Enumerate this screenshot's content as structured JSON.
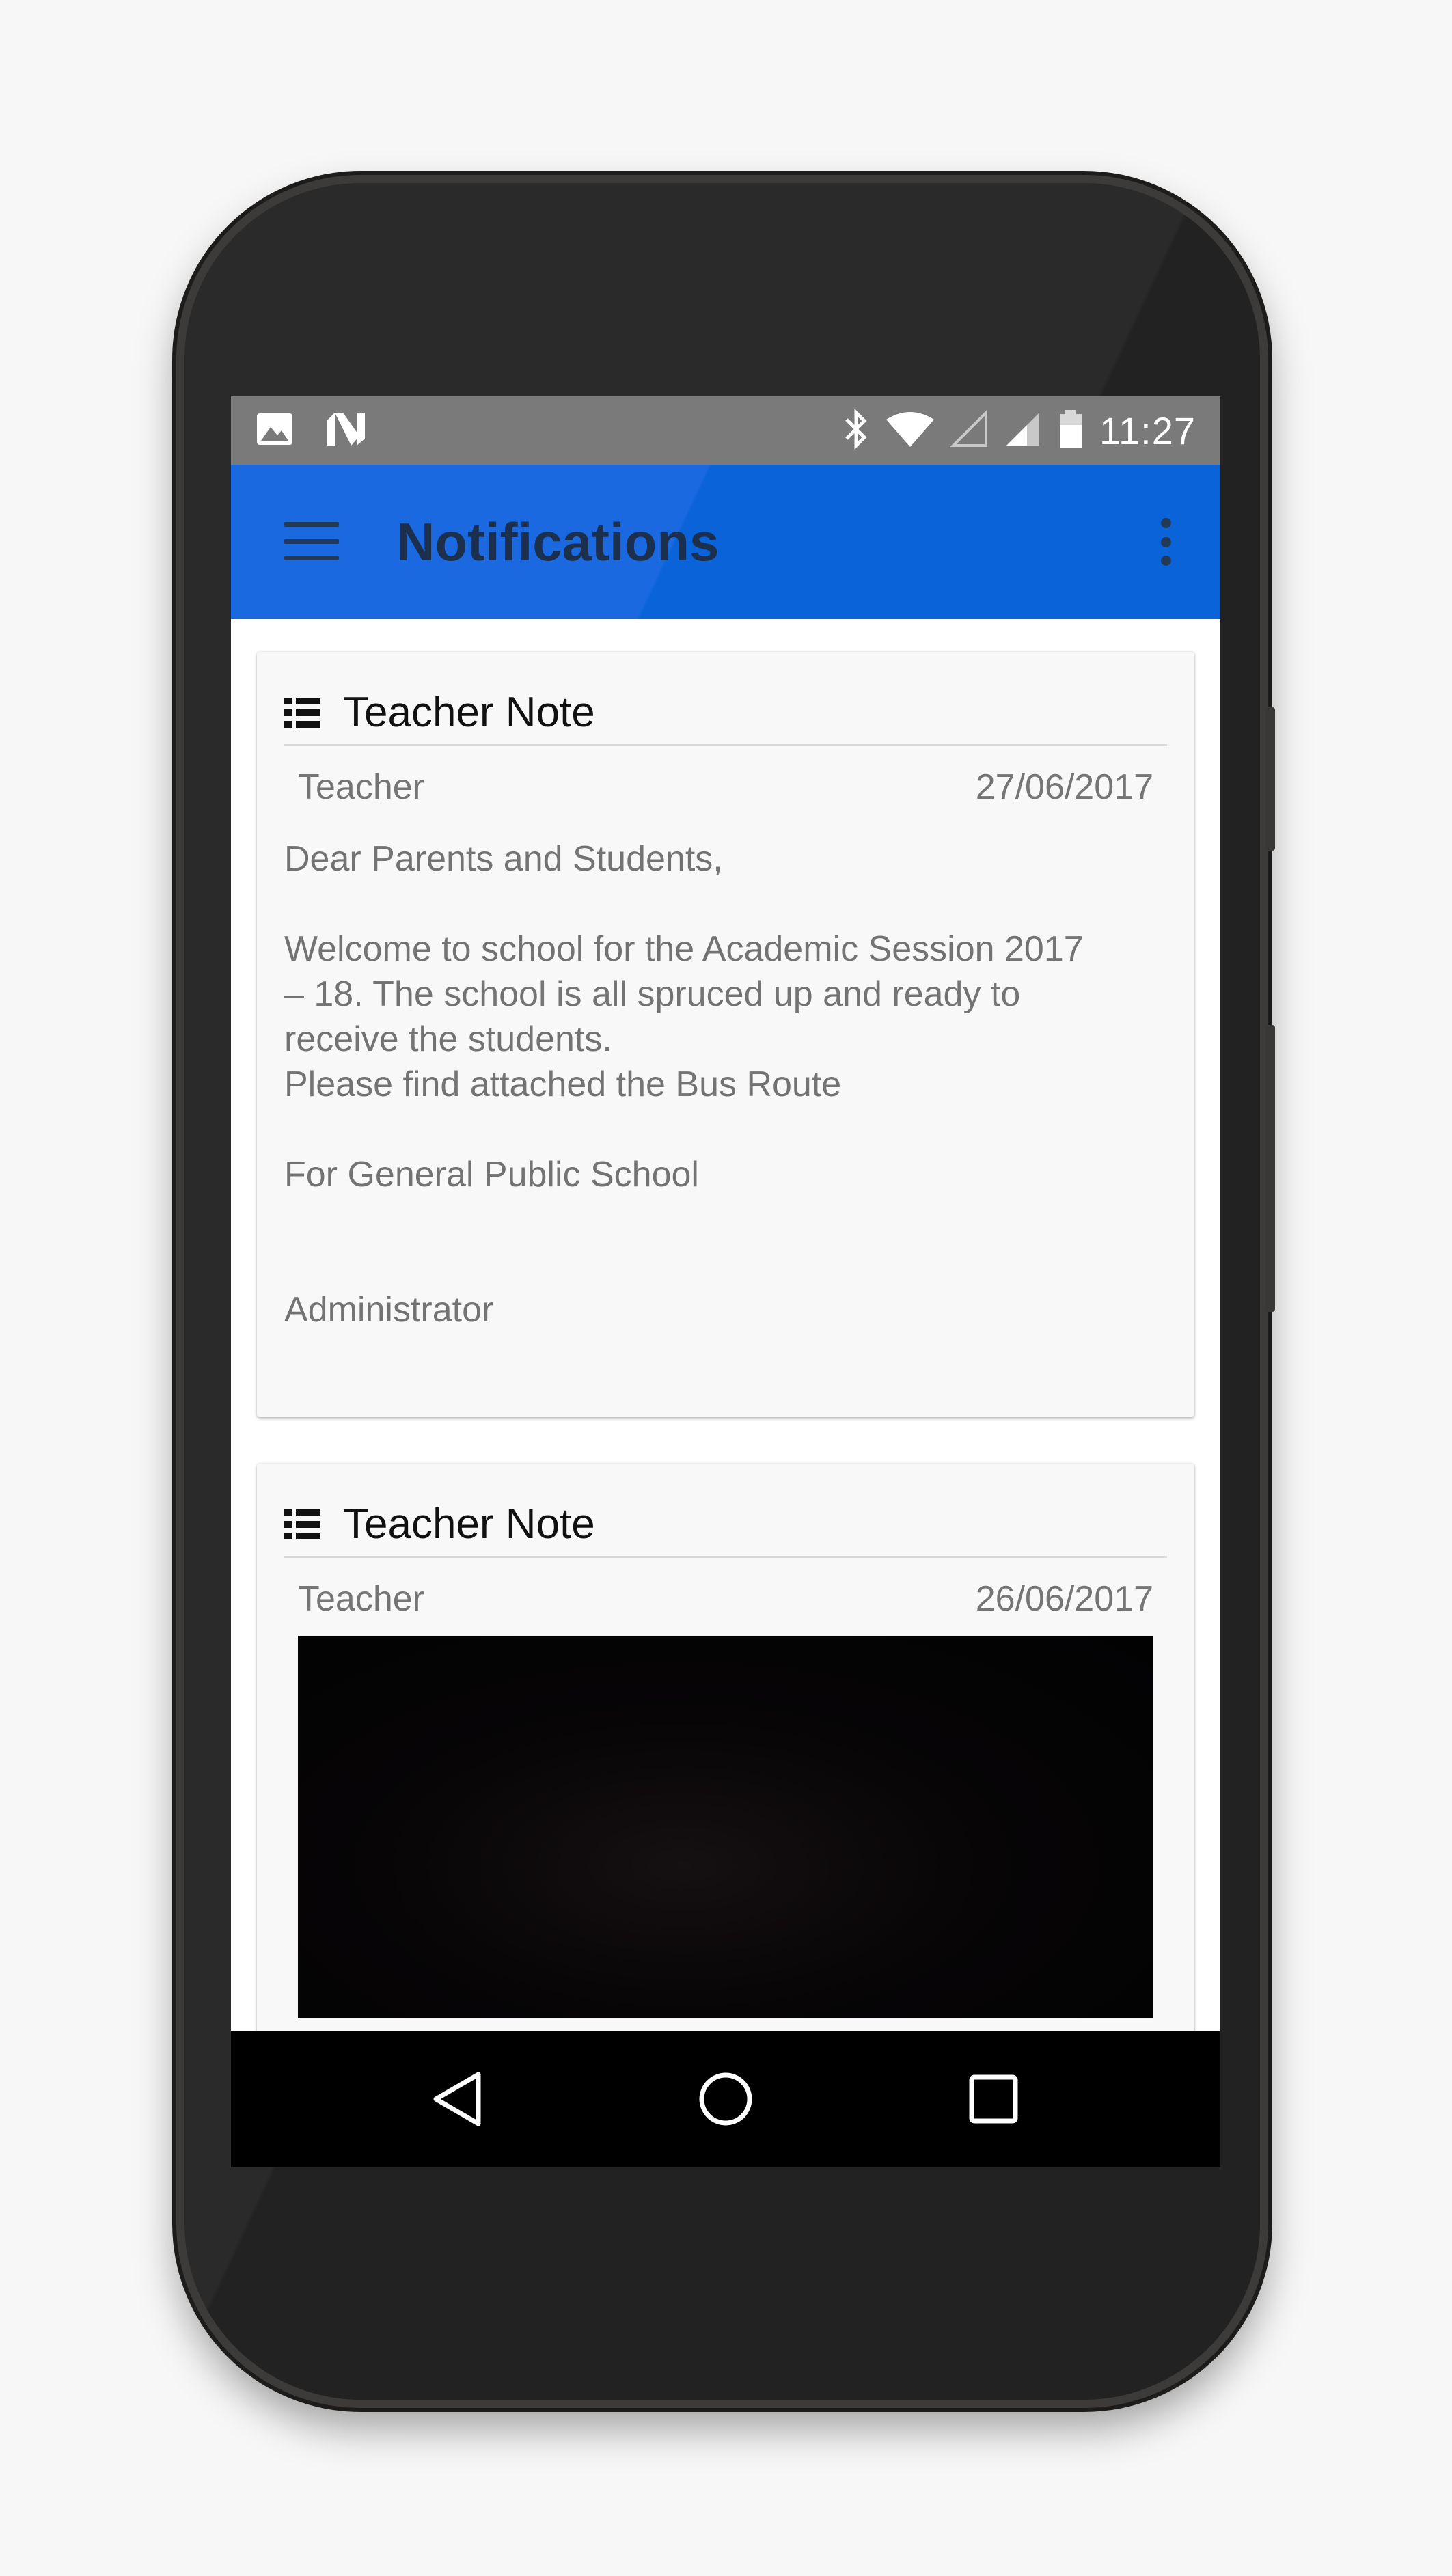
{
  "status_bar": {
    "time": "11:27",
    "left_icons": [
      "image-icon",
      "n-icon"
    ],
    "right_icons": [
      "bluetooth-icon",
      "wifi-icon",
      "signal-empty-icon",
      "signal-icon",
      "battery-icon"
    ]
  },
  "app_bar": {
    "title": "Notifications",
    "menu_icon": "hamburger-menu-icon",
    "overflow_icon": "more-vert-icon",
    "color": "#0a63d8"
  },
  "notifications": [
    {
      "title": "Teacher Note",
      "author": "Teacher",
      "date": "27/06/2017",
      "body": {
        "greeting": "Dear Parents and Students,",
        "line1": "Welcome to school for the Academic Session 2017",
        "line2": "– 18. The school is all spruced up and ready to",
        "line3": "receive the students.",
        "line4": "Please find attached the Bus Route",
        "line5": "For General Public School",
        "signature": "Administrator"
      }
    },
    {
      "title": "Teacher Note",
      "author": "Teacher",
      "date": "26/06/2017",
      "has_image": true
    }
  ],
  "nav_bar": {
    "back_icon": "back-triangle-icon",
    "home_icon": "home-circle-icon",
    "recents_icon": "recents-square-icon"
  }
}
